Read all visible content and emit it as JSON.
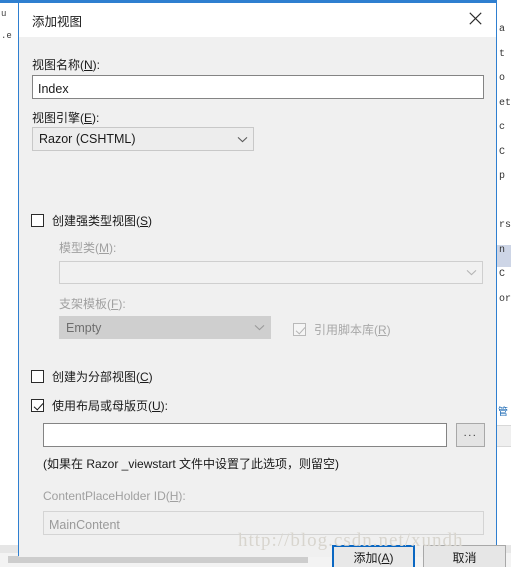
{
  "dialog": {
    "title": "添加视图",
    "close_icon": "close-icon"
  },
  "fields": {
    "view_name_label": "视图名称(N):",
    "view_name_value": "Index",
    "view_engine_label": "视图引擎(E):",
    "view_engine_value": "Razor (CSHTML)",
    "strongly_typed_label": "创建强类型视图(S)",
    "strongly_typed_checked": false,
    "model_class_label": "模型类(M):",
    "model_class_value": "",
    "scaffold_template_label": "支架模板(F):",
    "scaffold_template_value": "Empty",
    "reference_script_label": "引用脚本库(R)",
    "reference_script_checked": true,
    "partial_view_label": "创建为分部视图(C)",
    "partial_view_checked": false,
    "use_layout_label": "使用布局或母版页(U):",
    "use_layout_checked": true,
    "layout_path_value": "",
    "browse_button_label": "...",
    "layout_hint": "(如果在 Razor _viewstart 文件中设置了此选项，则留空)",
    "contentplaceholder_label": "ContentPlaceHolder ID(H):",
    "contentplaceholder_value": "MainContent"
  },
  "buttons": {
    "add_label": "添加(A)",
    "cancel_label": "取消"
  },
  "watermark": {
    "text": "http://blog.csdn.net/xundh"
  },
  "background": {
    "left_text": "u\n.e",
    "right_text": "a\nt\no\net\nc\nC\np\n\nrs\nn\nC\nor",
    "right_link": "管"
  },
  "colors": {
    "accent": "#2f7fd0",
    "primary_border": "#0a67c2",
    "dialog_bg": "#f0f0f0",
    "titlebar_bg": "#ffffff",
    "watermark": "#d8d5ce"
  }
}
